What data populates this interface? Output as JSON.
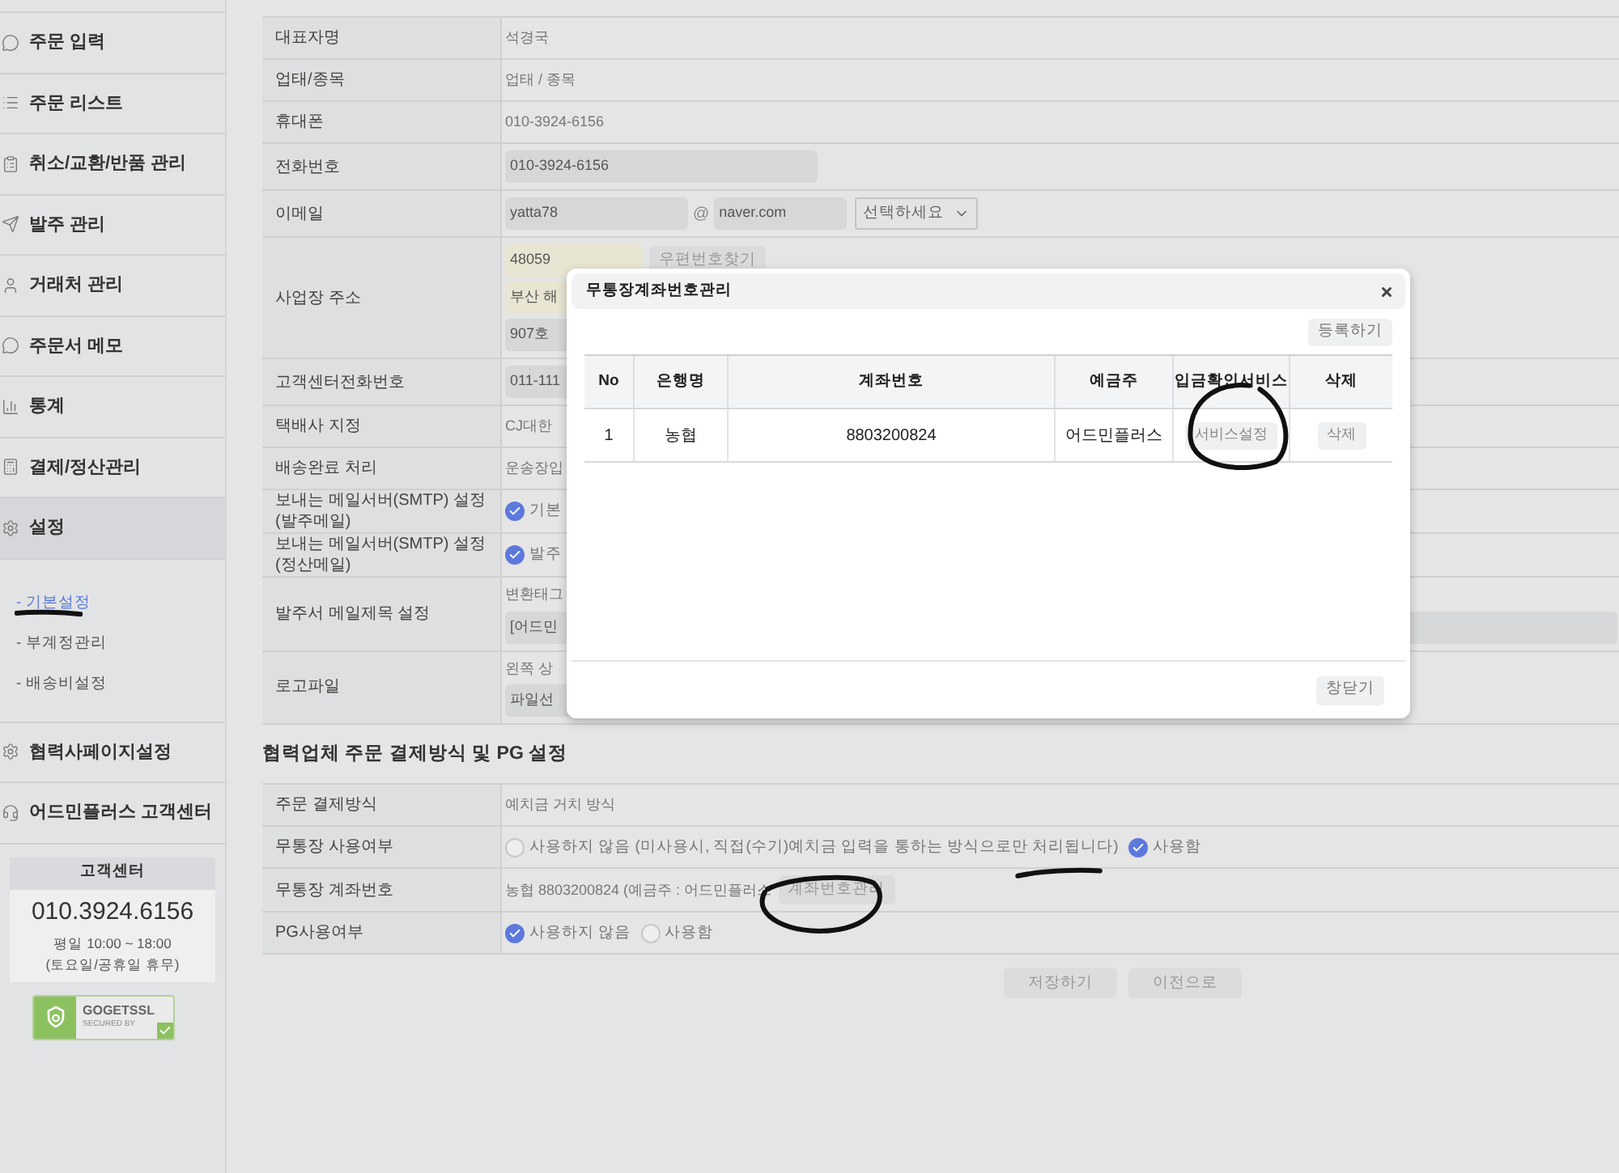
{
  "sidebar": {
    "items": [
      {
        "label": "주문 입력",
        "selected": false
      },
      {
        "label": "주문 리스트",
        "selected": false
      },
      {
        "label": "취소/교환/반품 관리",
        "selected": false
      },
      {
        "label": "발주 관리",
        "selected": false
      },
      {
        "label": "거래처 관리",
        "selected": false
      },
      {
        "label": "주문서 메모",
        "selected": false
      },
      {
        "label": "통계",
        "selected": false
      },
      {
        "label": "결제/정산관리",
        "selected": false
      },
      {
        "label": "설정",
        "selected": true,
        "children": [
          {
            "label": "- 기본설정",
            "selected": true
          },
          {
            "label": "- 부계정관리",
            "selected": false
          },
          {
            "label": "- 배송비설정",
            "selected": false
          }
        ]
      },
      {
        "label": "협력사페이지설정",
        "selected": false
      },
      {
        "label": "어드민플러스 고객센터",
        "selected": false
      }
    ],
    "support": {
      "title": "고객센터",
      "phone": "010.3924.6156",
      "hours": "평일 10:00 ~ 18:00",
      "note": "(토요일/공휴일 휴무)"
    },
    "badge": {
      "brand": "GOGETSSL",
      "sub": "SECURED BY"
    }
  },
  "form": {
    "rows": [
      {
        "label": [
          "대표자명"
        ],
        "lines": [
          [
            {
              "kind": "text",
              "text": "석경국"
            }
          ]
        ]
      },
      {
        "label": [
          "업태/종목"
        ],
        "lines": [
          [
            {
              "kind": "text",
              "text": "업태 / 종목"
            }
          ]
        ]
      },
      {
        "label": [
          "휴대폰"
        ],
        "lines": [
          [
            {
              "kind": "text",
              "text": "010-3924-6156"
            }
          ]
        ]
      },
      {
        "label": [
          "전화번호"
        ],
        "lines": [
          [
            {
              "kind": "input",
              "value": "010-3924-6156"
            }
          ]
        ]
      },
      {
        "label": [
          "이메일"
        ],
        "lines": [
          [
            {
              "kind": "input",
              "value": "yatta78"
            },
            {
              "kind": "sep",
              "text": "@"
            },
            {
              "kind": "input",
              "value": "naver.com"
            },
            {
              "kind": "select",
              "value": "선택하세요"
            }
          ]
        ]
      },
      {
        "label": [
          "사업장 주소"
        ],
        "lines": [
          [
            {
              "kind": "autofill",
              "value": "48059"
            },
            {
              "kind": "button",
              "label": "우편번호찾기"
            }
          ],
          [
            {
              "kind": "autofill",
              "value": "부산 해"
            }
          ],
          [
            {
              "kind": "input",
              "value": "907호"
            }
          ]
        ]
      },
      {
        "label": [
          "고객센터전화번호"
        ],
        "lines": [
          [
            {
              "kind": "input",
              "value": "011-111"
            }
          ]
        ]
      },
      {
        "label": [
          "택배사 지정"
        ],
        "lines": [
          [
            {
              "kind": "text",
              "text": "CJ대한"
            }
          ]
        ]
      },
      {
        "label": [
          "배송완료 처리"
        ],
        "lines": [
          [
            {
              "kind": "text",
              "text": "운송장입"
            }
          ]
        ]
      },
      {
        "label": [
          "보내는 메일서버(SMTP) 설정",
          "(발주메일)"
        ],
        "lines": [
          [
            {
              "kind": "radio",
              "label": "기본",
              "selected": true
            }
          ]
        ]
      },
      {
        "label": [
          "보내는 메일서버(SMTP) 설정",
          "(정산메일)"
        ],
        "lines": [
          [
            {
              "kind": "radio",
              "label": "발주",
              "selected": true
            }
          ]
        ]
      },
      {
        "label": [
          "발주서 메일제목 설정"
        ],
        "lines": [
          [
            {
              "kind": "text",
              "text": "변환태그"
            }
          ],
          [
            {
              "kind": "input",
              "value": "[어드민"
            }
          ]
        ]
      },
      {
        "label": [
          "로고파일"
        ],
        "lines": [
          [
            {
              "kind": "text",
              "text": "왼쪽 상"
            }
          ],
          [
            {
              "kind": "input",
              "value": "파일선"
            }
          ]
        ]
      }
    ]
  },
  "payment": {
    "title": "협력업체 주문 결제방식 및 PG 설정",
    "rows": [
      {
        "label": [
          "주문 결제방식"
        ],
        "lines": [
          [
            {
              "kind": "text",
              "text": "예치금 거치 방식"
            }
          ]
        ]
      },
      {
        "label": [
          "무통장 사용여부"
        ],
        "lines": [
          [
            {
              "kind": "radio",
              "label": "사용하지 않음 (미사용시, 직접(수기)예치금 입력을 통하는 방식으로만 처리됩니다)",
              "selected": false
            },
            {
              "kind": "radio",
              "label": "사용함",
              "selected": true
            }
          ]
        ]
      },
      {
        "label": [
          "무통장 계좌번호"
        ],
        "lines": [
          [
            {
              "kind": "text",
              "text": "농협 8803200824 (예금주 : 어드민플러스"
            },
            {
              "kind": "button",
              "label": "계좌번호관리"
            }
          ]
        ]
      },
      {
        "label": [
          "PG사용여부"
        ],
        "lines": [
          [
            {
              "kind": "radio",
              "label": "사용하지 않음",
              "selected": true
            },
            {
              "kind": "radio",
              "label": "사용함",
              "selected": false
            }
          ]
        ]
      }
    ]
  },
  "actions": [
    "저장하기",
    "이전으로"
  ],
  "modal": {
    "title": "무통장계좌번호관리",
    "register_button": "등록하기",
    "columns": [
      "No",
      "은행명",
      "계좌번호",
      "예금주",
      "입금확인서비스",
      "삭제"
    ],
    "rows": [
      {
        "no": "1",
        "bank": "농협",
        "account": "8803200824",
        "holder": "어드민플러스",
        "service_button": "서비스설정",
        "delete_button": "삭제"
      }
    ],
    "close_button": "창닫기"
  }
}
